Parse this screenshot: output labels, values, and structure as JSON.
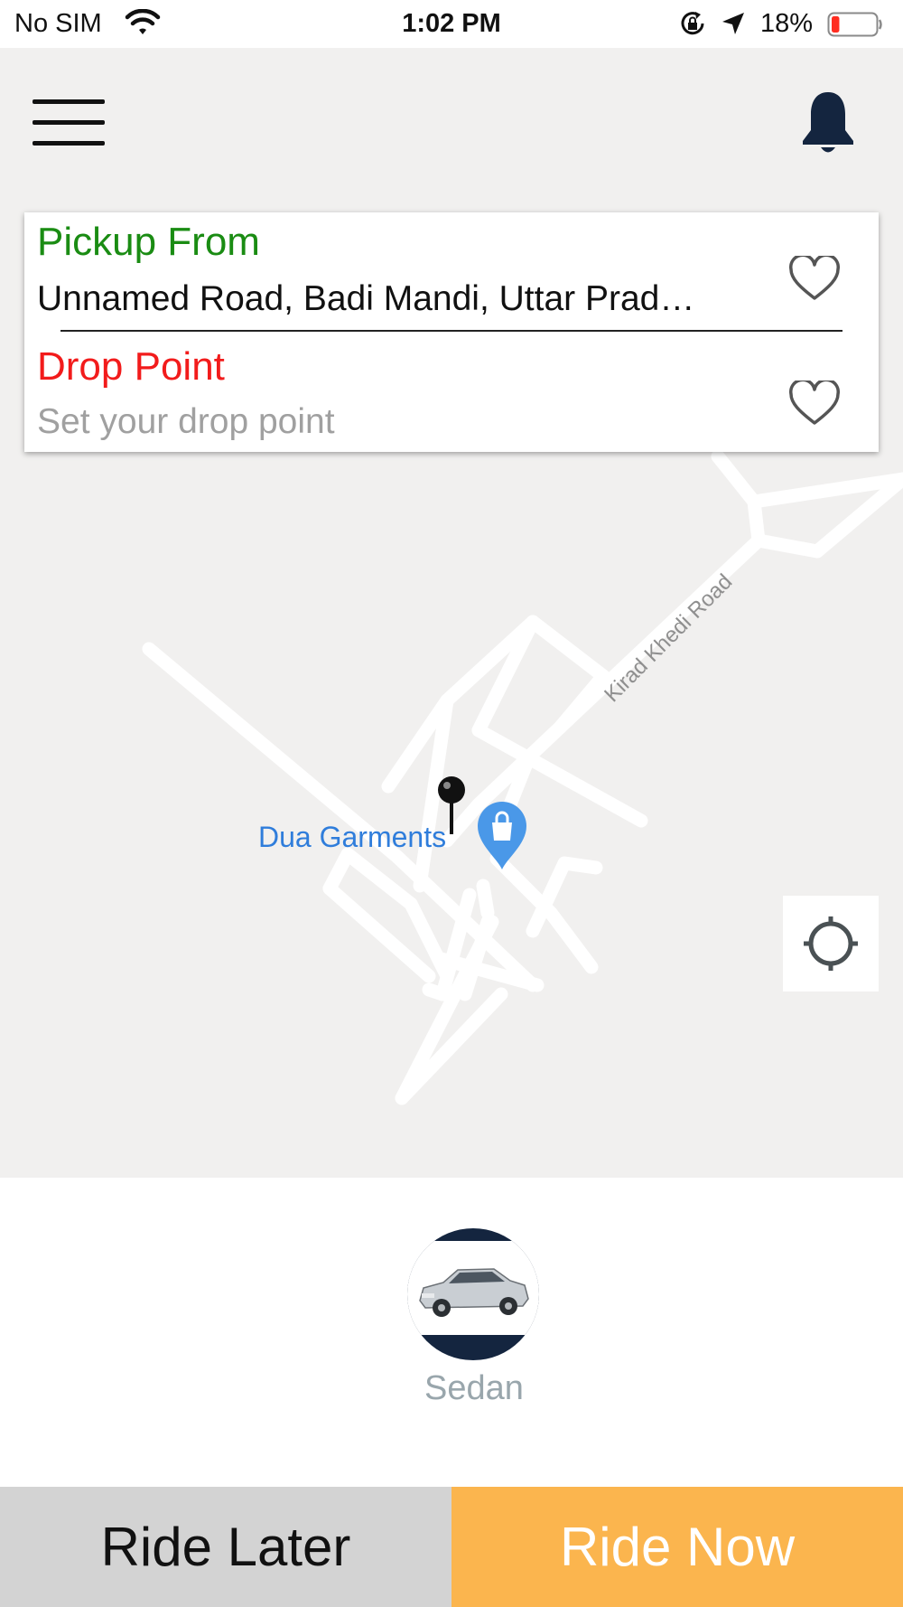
{
  "status_bar": {
    "carrier": "No SIM",
    "time": "1:02 PM",
    "battery_percent": "18%",
    "battery_level": 0.18,
    "icons": [
      "wifi-icon",
      "rotation-lock-icon",
      "location-arrow-icon",
      "battery-icon"
    ]
  },
  "header": {
    "menu_icon": "hamburger-menu-icon",
    "notification_icon": "bell-icon"
  },
  "location_card": {
    "pickup_label": "Pickup From",
    "pickup_address": "Unnamed Road, Badi Mandi, Uttar Prad…",
    "drop_label": "Drop Point",
    "drop_value": "",
    "drop_placeholder": "Set your drop point",
    "favorite_icon": "heart-outline-icon"
  },
  "map": {
    "road_label": "Kirad Khedi Road",
    "poi_label": "Dua Garments",
    "pin_icon": "map-pin-icon",
    "poi_icon": "shopping-bag-marker-icon",
    "locate_icon": "crosshair-icon"
  },
  "vehicles": [
    {
      "name": "Sedan",
      "icon": "sedan-car-image"
    }
  ],
  "actions": {
    "ride_later": "Ride Later",
    "ride_now": "Ride Now"
  },
  "colors": {
    "pickup": "#1a8c13",
    "drop": "#f21b1b",
    "ride_now_bg": "#fbb54e",
    "ride_later_bg": "#d3d3d3",
    "poi": "#2f7ddb",
    "vehicle_circle": "#14253f"
  }
}
